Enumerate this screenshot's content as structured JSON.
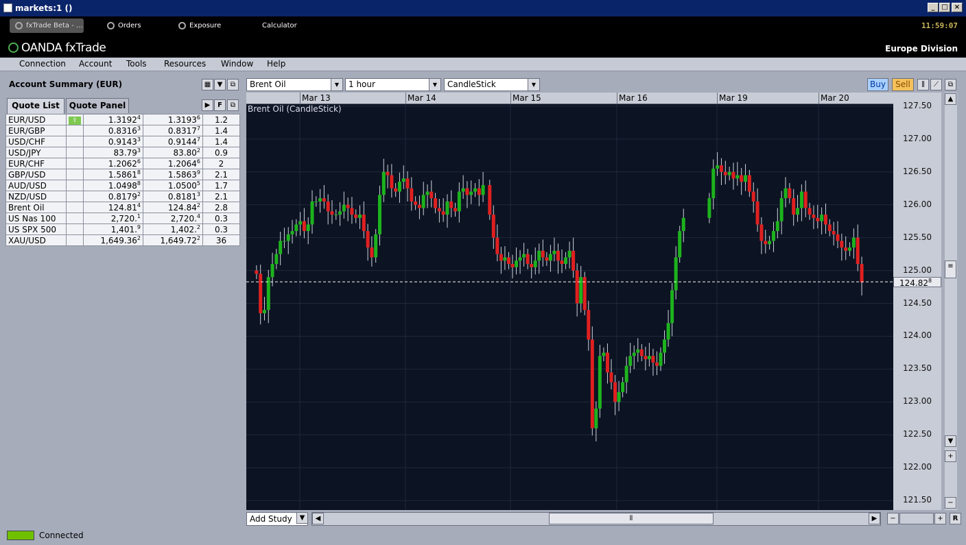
{
  "window": {
    "title": "markets:1 ()"
  },
  "nav": {
    "tabs": [
      {
        "label": "fxTrade Beta - ..."
      },
      {
        "label": "Orders"
      },
      {
        "label": "Exposure"
      },
      {
        "label": "Calculator"
      }
    ],
    "clock": "11:59:07"
  },
  "brand": {
    "logo": "OANDA fxTrade",
    "division": "Europe Division"
  },
  "menu": [
    "Connection",
    "Account",
    "Tools",
    "Resources",
    "Window",
    "Help"
  ],
  "account": {
    "title": "Account Summary (EUR)"
  },
  "quote_tabs": [
    "Quote List",
    "Quote Panel"
  ],
  "quote_tools": {
    "f_label": "F"
  },
  "quotes": [
    {
      "symbol": "EUR/USD",
      "bid": "1.3192",
      "bid_sup": "4",
      "ask": "1.3193",
      "ask_sup": "6",
      "spread": "1.2",
      "up": true
    },
    {
      "symbol": "EUR/GBP",
      "bid": "0.8316",
      "bid_sup": "3",
      "ask": "0.8317",
      "ask_sup": "7",
      "spread": "1.4"
    },
    {
      "symbol": "USD/CHF",
      "bid": "0.9143",
      "bid_sup": "3",
      "ask": "0.9144",
      "ask_sup": "7",
      "spread": "1.4"
    },
    {
      "symbol": "USD/JPY",
      "bid": "83.79",
      "bid_sup": "3",
      "ask": "83.80",
      "ask_sup": "2",
      "spread": "0.9"
    },
    {
      "symbol": "EUR/CHF",
      "bid": "1.2062",
      "bid_sup": "6",
      "ask": "1.2064",
      "ask_sup": "6",
      "spread": "2"
    },
    {
      "symbol": "GBP/USD",
      "bid": "1.5861",
      "bid_sup": "8",
      "ask": "1.5863",
      "ask_sup": "9",
      "spread": "2.1"
    },
    {
      "symbol": "AUD/USD",
      "bid": "1.0498",
      "bid_sup": "8",
      "ask": "1.0500",
      "ask_sup": "5",
      "spread": "1.7"
    },
    {
      "symbol": "NZD/USD",
      "bid": "0.8179",
      "bid_sup": "2",
      "ask": "0.8181",
      "ask_sup": "3",
      "spread": "2.1"
    },
    {
      "symbol": "Brent Oil",
      "bid": "124.81",
      "bid_sup": "4",
      "ask": "124.84",
      "ask_sup": "2",
      "spread": "2.8"
    },
    {
      "symbol": "US Nas 100",
      "bid": "2,720.",
      "bid_sup": "1",
      "ask": "2,720.",
      "ask_sup": "4",
      "spread": "0.3"
    },
    {
      "symbol": "US SPX 500",
      "bid": "1,401.",
      "bid_sup": "9",
      "ask": "1,402.",
      "ask_sup": "2",
      "spread": "0.3"
    },
    {
      "symbol": "XAU/USD",
      "bid": "1,649.36",
      "bid_sup": "2",
      "ask": "1,649.72",
      "ask_sup": "2",
      "spread": "36"
    }
  ],
  "chart_controls": {
    "instrument": "Brent Oil",
    "interval": "1 hour",
    "chart_type": "CandleStick",
    "buy_label": "Buy",
    "sell_label": "Sell",
    "add_study": "Add Study",
    "reset_label": "R"
  },
  "status": {
    "text": "Connected",
    "led_color": "#6fc000"
  },
  "colors": {
    "up": "#1db31d",
    "down": "#e02020",
    "chart_bg": "#0c1322",
    "grid": "#1e2a3c"
  },
  "chart_data": {
    "type": "candlestick",
    "title": "Brent Oil (CandleStick)",
    "x_ticks": [
      "Mar 13",
      "Mar 14",
      "Mar 15",
      "Mar 16",
      "Mar 19",
      "Mar 20"
    ],
    "y_ticks": [
      "121.50",
      "122.00",
      "122.50",
      "123.00",
      "123.50",
      "124.00",
      "124.50",
      "125.00",
      "125.50",
      "126.00",
      "126.50",
      "127.00",
      "127.50"
    ],
    "ylim": [
      121.45,
      127.53
    ],
    "current_price": "124.82",
    "current_price_sup": "8",
    "current_price_value": 124.828,
    "series": [
      {
        "segment": 0,
        "closes": [
          124.95,
          124.35,
          124.4,
          124.9,
          125.1,
          125.25,
          125.45,
          125.45,
          125.55,
          125.6,
          125.7,
          125.75,
          125.6,
          125.7,
          126.05,
          126.05,
          126.1,
          126.05,
          125.9,
          125.85,
          125.85,
          125.9,
          126.0,
          125.95,
          125.85,
          125.8,
          125.85,
          125.6,
          125.35,
          125.2,
          125.55,
          126.15,
          126.5,
          126.45,
          126.25,
          126.2,
          126.35,
          126.4,
          126.25,
          126.05,
          126.0,
          125.95,
          126.15,
          126.2,
          126.1,
          125.95,
          125.9,
          125.85,
          126.05,
          125.95,
          125.9,
          126.2,
          126.25,
          126.15,
          126.2,
          126.25,
          126.15,
          126.3
        ]
      },
      {
        "segment": 1,
        "closes": [
          125.85,
          125.5,
          125.25,
          125.15,
          125.2,
          125.1,
          125.05,
          125.15,
          125.2,
          125.25,
          125.1,
          125.05,
          125.15,
          125.3,
          125.2,
          125.15,
          125.25,
          125.3,
          125.15,
          125.1,
          125.2,
          125.3,
          125.0,
          124.5,
          124.9,
          124.4,
          123.95,
          122.6,
          122.9,
          123.7,
          123.75,
          123.45,
          123.3,
          123.0,
          123.15,
          123.3,
          123.55,
          123.7,
          123.75,
          123.8,
          123.7,
          123.65,
          123.7,
          123.6,
          123.55,
          123.75,
          123.95,
          124.2,
          124.7,
          125.2,
          125.6,
          125.8
        ]
      },
      {
        "segment": 2,
        "closes": [
          126.1,
          126.55,
          126.6,
          126.5,
          126.45,
          126.5,
          126.4,
          126.45,
          126.35,
          126.45,
          126.2,
          126.05,
          125.7,
          125.45,
          125.4,
          125.45,
          125.6,
          125.75,
          126.1,
          126.25,
          126.1,
          125.85,
          125.95,
          126.2,
          125.95,
          125.85,
          125.8,
          125.75,
          125.85,
          125.7,
          125.6,
          125.55,
          125.45,
          125.35,
          125.3,
          125.35,
          125.5,
          125.1,
          124.82
        ]
      }
    ]
  }
}
